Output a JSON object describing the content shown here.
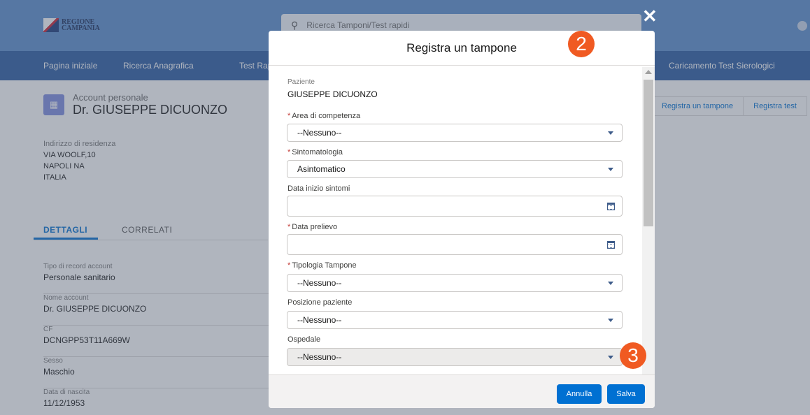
{
  "header": {
    "logo_line1": "REGIONE",
    "logo_line2": "CAMPANIA",
    "search_placeholder": "Ricerca Tamponi/Test rapidi"
  },
  "nav": {
    "items": [
      "Pagina iniziale",
      "Ricerca Anagrafica",
      "Test Rap",
      "Caricamento Test Sierologici"
    ]
  },
  "record": {
    "type": "Account personale",
    "name": "Dr. GIUSEPPE DICUONZO",
    "address_label": "Indirizzo di residenza",
    "address_lines": [
      "VIA WOOLF,10",
      "NAPOLI NA",
      "ITALIA"
    ]
  },
  "tabs": {
    "active": "DETTAGLI",
    "inactive": "CORRELATI"
  },
  "details": [
    {
      "label": "Tipo di record account",
      "value": "Personale sanitario"
    },
    {
      "label": "Nome account",
      "value": "Dr. GIUSEPPE DICUONZO"
    },
    {
      "label": "CF",
      "value": "DCNGPP53T11A669W"
    },
    {
      "label": "Sesso",
      "value": "Maschio"
    },
    {
      "label": "Data di nascita",
      "value": "11/12/1953"
    }
  ],
  "actions": [
    "Registra un tampone",
    "Registra test"
  ],
  "modal": {
    "title": "Registra un tampone",
    "close": "✕",
    "paziente_label": "Paziente",
    "paziente_value": "GIUSEPPE DICUONZO",
    "fields": {
      "area": {
        "label": "Area di competenza",
        "required": "*",
        "value": "--Nessuno--"
      },
      "sintomatologia": {
        "label": "Sintomatologia",
        "required": "*",
        "value": "Asintomatico"
      },
      "data_inizio": {
        "label": "Data inizio sintomi"
      },
      "data_prelievo": {
        "label": "Data prelievo",
        "required": "*"
      },
      "tipologia": {
        "label": "Tipologia Tampone",
        "required": "*",
        "value": "--Nessuno--"
      },
      "posizione": {
        "label": "Posizione paziente",
        "value": "--Nessuno--"
      },
      "ospedale": {
        "label": "Ospedale",
        "value": "--Nessuno--"
      }
    },
    "cancel_label": "Annulla",
    "save_label": "Salva"
  },
  "annotations": {
    "step2": "2",
    "step3": "3"
  },
  "colors": {
    "topbar": "#5b8fce",
    "navbar": "#2a5ca3",
    "primary_button": "#0070d2",
    "badge": "#f05a22"
  }
}
